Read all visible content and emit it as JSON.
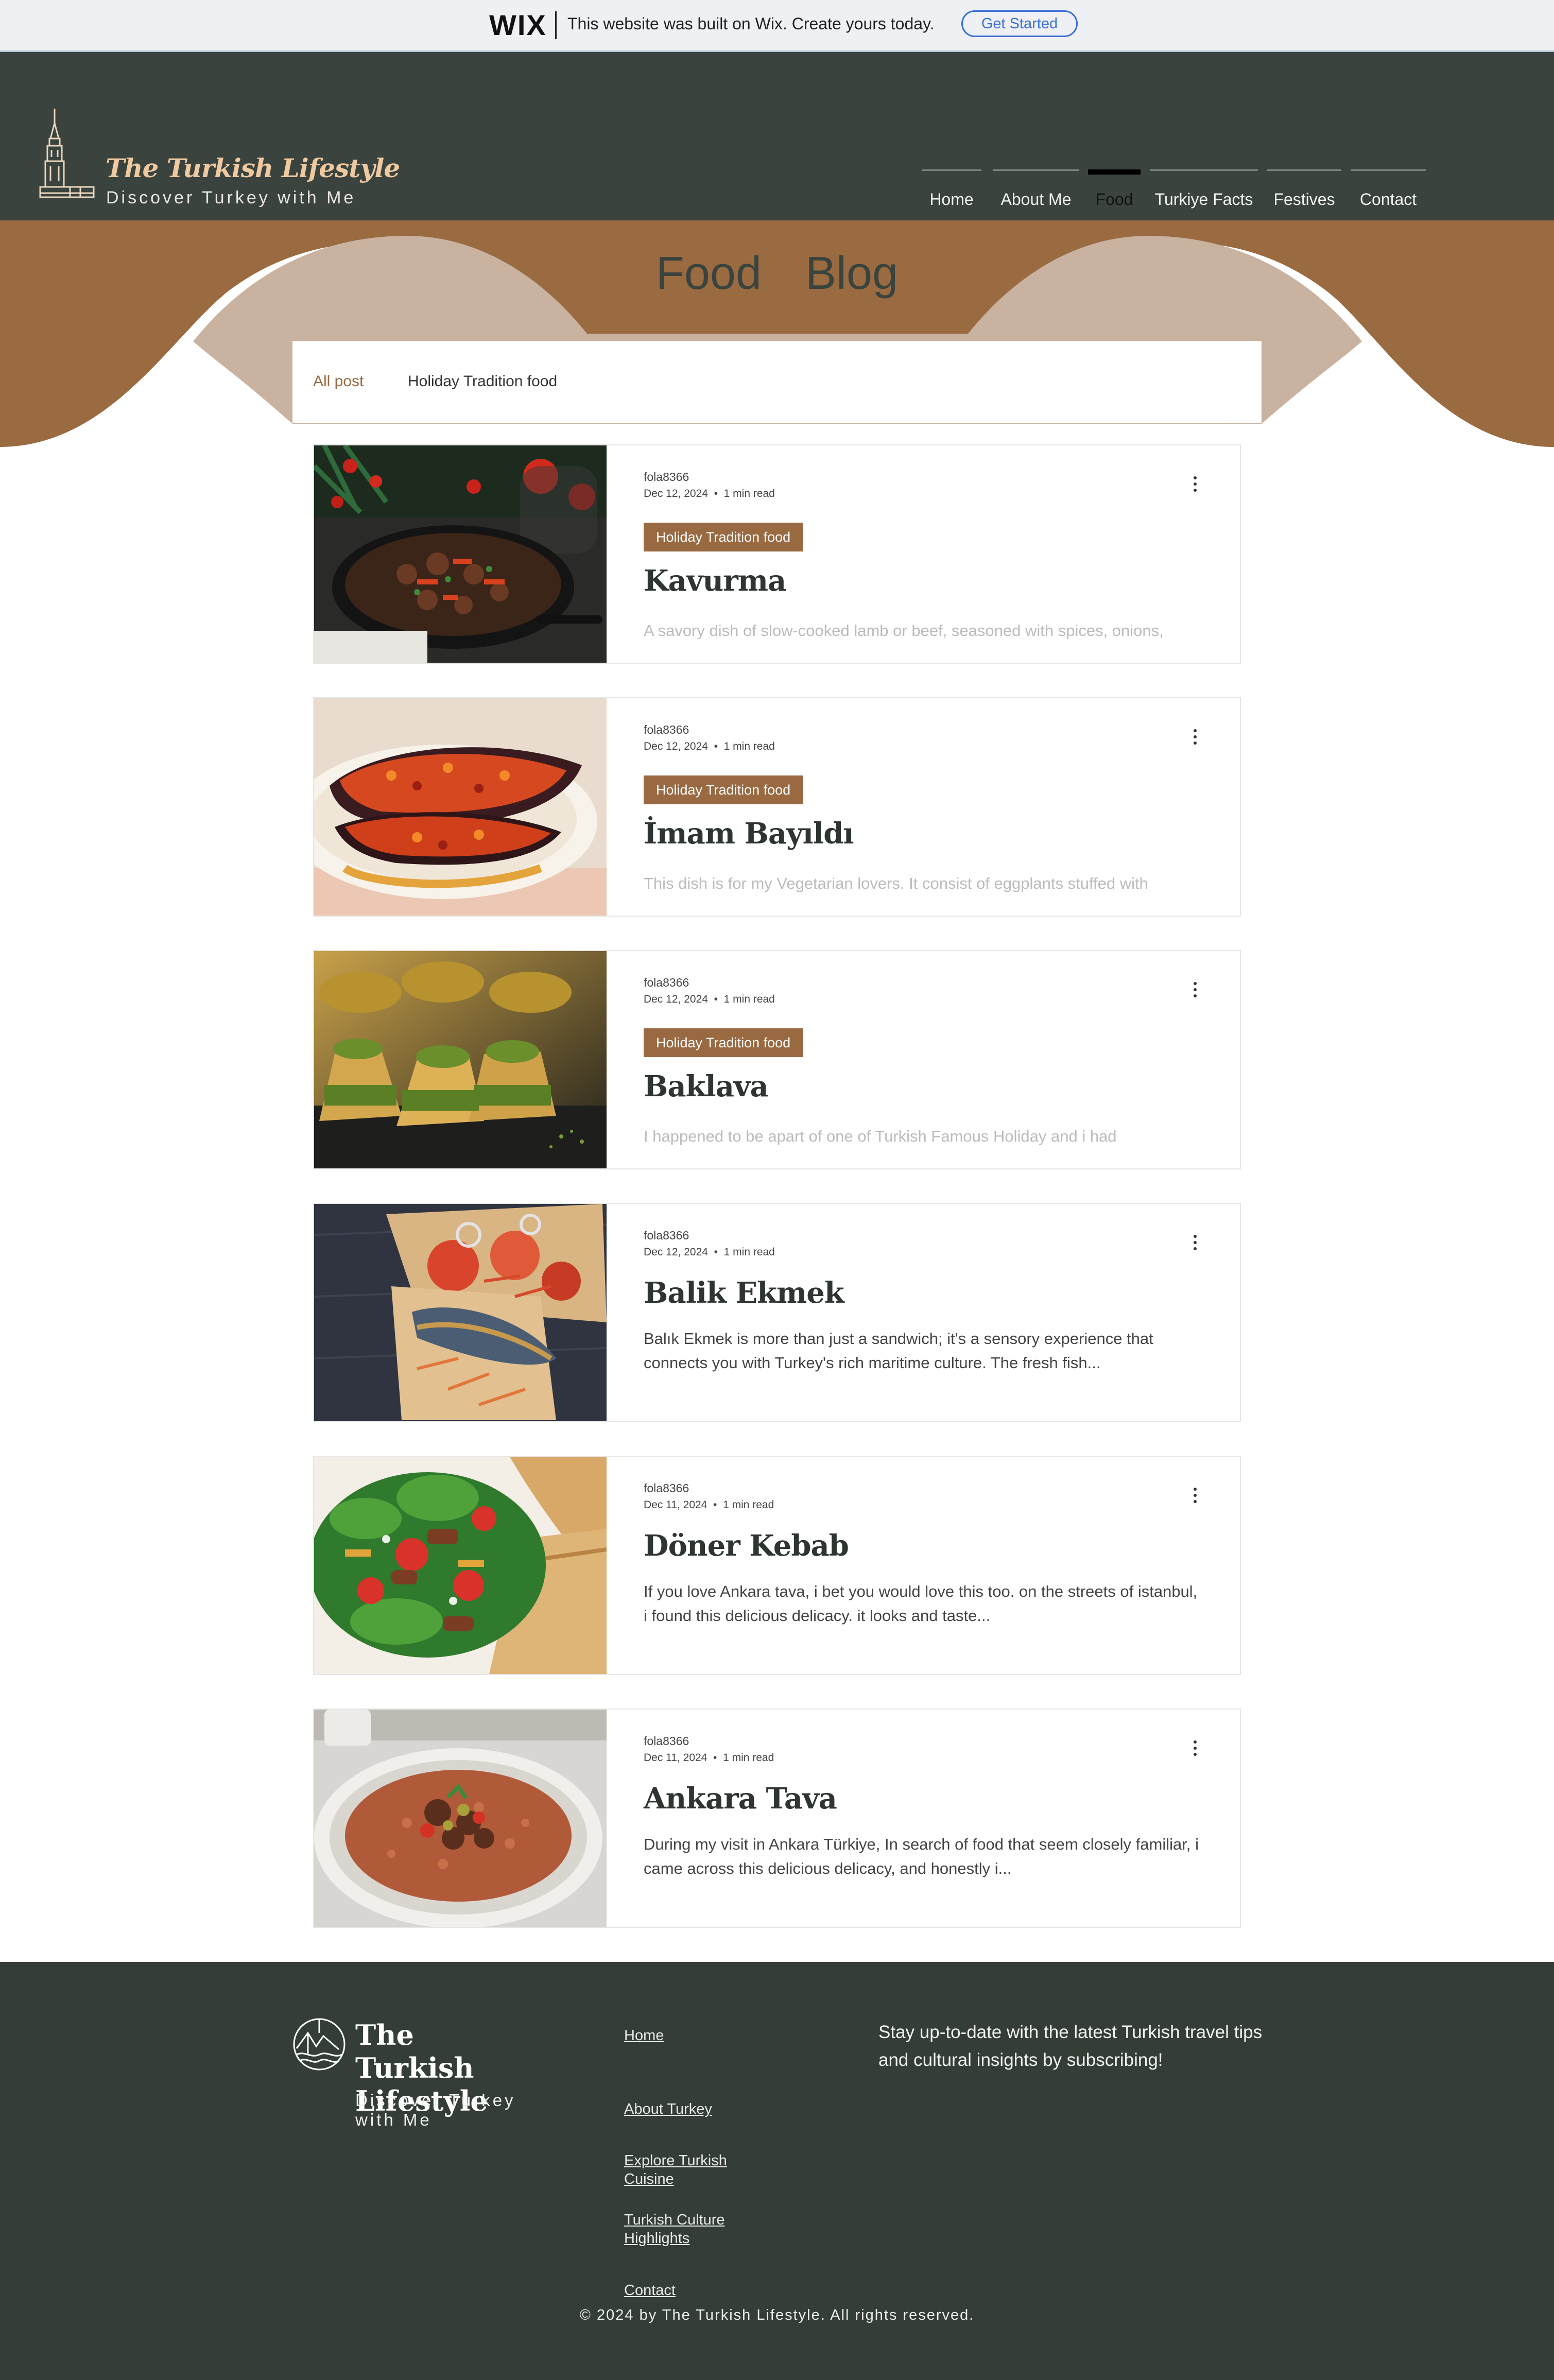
{
  "wix_banner": {
    "logo": "WIX",
    "message": "This website was built on Wix. Create yours today.",
    "cta": "Get Started"
  },
  "header": {
    "brand_title": "The Turkish Lifestyle",
    "brand_subtitle": "Discover Turkey with Me",
    "logo_icon": "galata-tower-icon",
    "nav": [
      "Home",
      "About Me",
      "Food",
      "Turkiye Facts",
      "Festives",
      "Contact"
    ],
    "active_nav": "Food"
  },
  "hero": {
    "title": "Food Blog"
  },
  "filters": {
    "all": "All post",
    "category": "Holiday Tradition food"
  },
  "posts": [
    {
      "author": "fola8366",
      "date": "Dec 12, 2024",
      "read": "1 min read",
      "tag": "Holiday Tradition food",
      "title": "Kavurma",
      "excerpt": "A savory dish of slow-cooked lamb or beef, seasoned with spices, onions,"
    },
    {
      "author": "fola8366",
      "date": "Dec 12, 2024",
      "read": "1 min read",
      "tag": "Holiday Tradition food",
      "title": "İmam Bayıldı",
      "excerpt": "This dish is for my Vegetarian lovers. It consist of eggplants stuffed with"
    },
    {
      "author": "fola8366",
      "date": "Dec 12, 2024",
      "read": "1 min read",
      "tag": "Holiday Tradition food",
      "title": "Baklava",
      "excerpt": "I happened to be apart of one of Turkish Famous Holiday and i had"
    },
    {
      "author": "fola8366",
      "date": "Dec 12, 2024",
      "read": "1 min read",
      "tag": "",
      "title": "Balik Ekmek",
      "excerpt": "Balık Ekmek is more than just a sandwich; it's a sensory experience that connects you with Turkey's rich maritime culture. The fresh fish..."
    },
    {
      "author": "fola8366",
      "date": "Dec 11, 2024",
      "read": "1 min read",
      "tag": "",
      "title": "Döner Kebab",
      "excerpt": "If you love Ankara tava, i bet you would love this too. on the streets of istanbul, i found this delicious delicacy. it looks and taste..."
    },
    {
      "author": "fola8366",
      "date": "Dec 11, 2024",
      "read": "1 min read",
      "tag": "",
      "title": "Ankara Tava",
      "excerpt": "During my visit in Ankara Türkiye, In search of food that seem closely familiar, i came across this delicious delicacy, and honestly i..."
    }
  ],
  "footer": {
    "brand_title": "The Turkish Lifestyle",
    "brand_subtitle": "Discover Turkey with Me",
    "links": [
      "Home",
      "About Turkey",
      "Explore Turkish Cuisine",
      "Turkish Culture Highlights",
      "Contact"
    ],
    "newsletter": "Stay up-to-date with the latest Turkish travel tips and cultural insights by subscribing!",
    "copyright": "© 2024 by The Turkish Lifestyle. All rights reserved."
  },
  "colors": {
    "header_bg": "#3a433e",
    "hero_brown": "#9a6b41",
    "hero_light": "#c9b29f",
    "tag_bg": "#996941",
    "footer_bg": "#343e36",
    "wix_blue": "#3a6fd8"
  }
}
